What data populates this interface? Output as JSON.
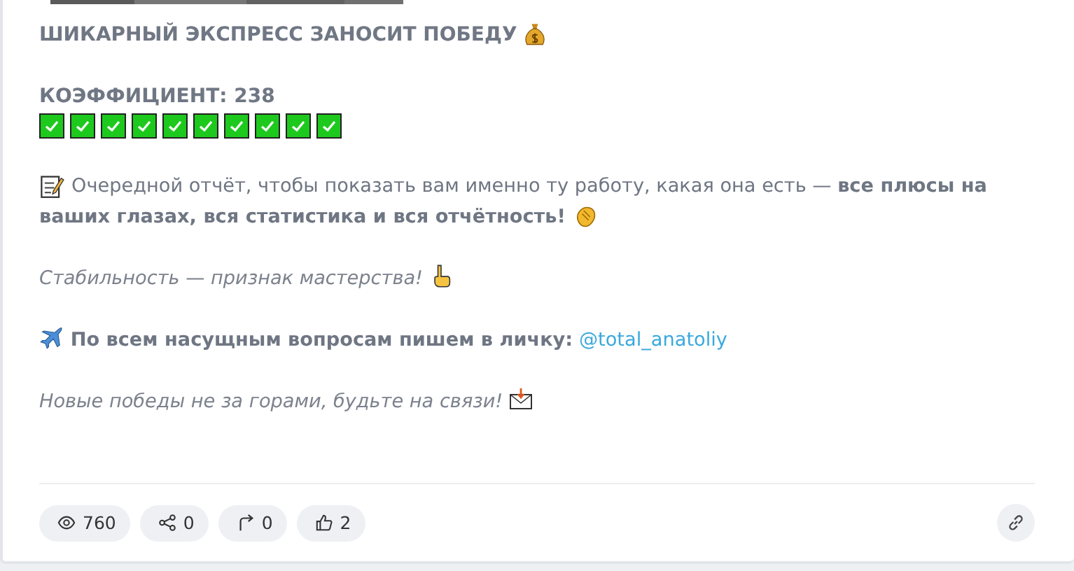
{
  "post": {
    "title": "ШИКАРНЫЙ ЭКСПРЕСС ЗАНОСИТ ПОБЕДУ",
    "coefficient": "КОЭФФИЦИЕНТ: 238",
    "check_marks": [
      {
        "kind": "check"
      },
      {
        "kind": "check"
      },
      {
        "kind": "check"
      },
      {
        "kind": "check"
      },
      {
        "kind": "check"
      },
      {
        "kind": "check"
      },
      {
        "kind": "check"
      },
      {
        "kind": "check"
      },
      {
        "kind": "check"
      },
      {
        "kind": "check"
      }
    ],
    "report_lines": [
      "Очередной отчёт, чтобы показать вам именно ту работу, какая она есть — **все плюсы на**",
      "**ваших глазах, вся статистика и вся отчётность!**"
    ],
    "motto": "Стабильность — признак мастерства!",
    "contact": "По всем насущным вопросам пишем в личку:",
    "contact_link": "@total_anatoliy",
    "closing": "Новые победы не за горами, будьте на связи!"
  },
  "stats": [
    {
      "kind": "views",
      "value": "760"
    },
    {
      "kind": "shares",
      "value": "0"
    },
    {
      "kind": "reposts",
      "value": "0"
    },
    {
      "kind": "likes",
      "value": "2"
    }
  ]
}
